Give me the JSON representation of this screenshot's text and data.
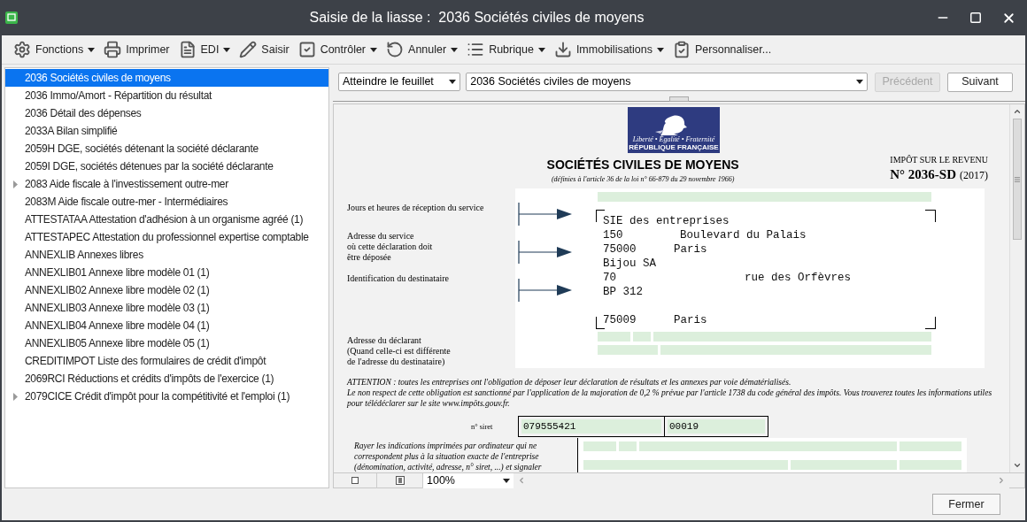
{
  "window": {
    "title": "Saisie de la liasse :  2036 Sociétés civiles de moyens"
  },
  "toolbar": [
    {
      "label": "Fonctions",
      "has_menu": true
    },
    {
      "label": "Imprimer",
      "has_menu": false
    },
    {
      "label": "EDI",
      "has_menu": true
    },
    {
      "label": "Saisir",
      "has_menu": false
    },
    {
      "label": "Contrôler",
      "has_menu": true
    },
    {
      "label": "Annuler",
      "has_menu": true
    },
    {
      "label": "Rubrique",
      "has_menu": true
    },
    {
      "label": "Immobilisations",
      "has_menu": true
    },
    {
      "label": "Personnaliser...",
      "has_menu": false
    }
  ],
  "sidebar": {
    "items": [
      {
        "label": "2036 Sociétés civiles de moyens",
        "kind": "leaf",
        "selected": true
      },
      {
        "label": "2036 Immo/Amort - Répartition du résultat",
        "kind": "leaf",
        "selected": false
      },
      {
        "label": "2036 Détail des dépenses",
        "kind": "leaf",
        "selected": false
      },
      {
        "label": "2033A Bilan simplifié",
        "kind": "leaf",
        "selected": false
      },
      {
        "label": "2059H DGE, sociétés détenant la société déclarante",
        "kind": "leaf",
        "selected": false
      },
      {
        "label": "2059I DGE, sociétés détenues par la société déclarante",
        "kind": "leaf",
        "selected": false
      },
      {
        "label": "2083 Aide fiscale à l'investissement outre-mer",
        "kind": "group",
        "selected": false
      },
      {
        "label": "2083M Aide fiscale outre-mer - Intermédiaires",
        "kind": "leaf",
        "selected": false
      },
      {
        "label": "ATTESTATAA Attestation d'adhésion à un organisme agréé (1)",
        "kind": "leaf",
        "selected": false
      },
      {
        "label": "ATTESTAPEC Attestation du professionnel expertise comptable",
        "kind": "leaf",
        "selected": false
      },
      {
        "label": "ANNEXLIB Annexes libres",
        "kind": "leaf",
        "selected": false
      },
      {
        "label": "ANNEXLIB01 Annexe libre modèle 01 (1)",
        "kind": "leaf",
        "selected": false
      },
      {
        "label": "ANNEXLIB02 Annexe libre modèle 02 (1)",
        "kind": "leaf",
        "selected": false
      },
      {
        "label": "ANNEXLIB03 Annexe libre modèle 03 (1)",
        "kind": "leaf",
        "selected": false
      },
      {
        "label": "ANNEXLIB04 Annexe libre modèle 04 (1)",
        "kind": "leaf",
        "selected": false
      },
      {
        "label": "ANNEXLIB05 Annexe libre modèle 05 (1)",
        "kind": "leaf",
        "selected": false
      },
      {
        "label": "CREDITIMPOT Liste des formulaires de crédit d'impôt",
        "kind": "leaf",
        "selected": false
      },
      {
        "label": "2069RCI Réductions et crédits d'impôts de l'exercice (1)",
        "kind": "leaf",
        "selected": false
      },
      {
        "label": "2079CICE Crédit d'impôt pour la compétitivité et l'emploi (1)",
        "kind": "group",
        "selected": false
      }
    ]
  },
  "navigation": {
    "goto_select": "Atteindre le feuillet",
    "sheet_select": "2036 Sociétés civiles de moyens",
    "previous": {
      "label": "Précédent",
      "disabled": true
    },
    "next": {
      "label": "Suivant",
      "disabled": false
    }
  },
  "form": {
    "logo": {
      "motto": "Liberté • Égalité • Fraternité",
      "name": "RÉPUBLIQUE FRANÇAISE"
    },
    "title": "SOCIÉTÉS CIVILES DE MOYENS",
    "subtitle": "(définies à l'article 36 de la loi n° 66-879 du 29 novembre 1966)",
    "tax_label": "IMPÔT SUR LE REVENU",
    "form_number": "N° 2036-SD",
    "year": "(2017)",
    "labels": {
      "reception": "Jours et heures de réception du service",
      "service": "Adresse du service\noù cette déclaration doit\nêtre déposée",
      "recipient": "Identification du destinataire",
      "declarant": "Adresse du déclarant\n(Quand celle-ci est différente\nde l'adresse du destinataire)"
    },
    "address_lines": [
      {
        "kind": "text",
        "parts": [
          "SIE des entreprises"
        ]
      },
      {
        "kind": "service_street",
        "parts": [
          "150",
          "Boulevard du Palais"
        ]
      },
      {
        "kind": "city",
        "parts": [
          "75000",
          "Paris"
        ]
      },
      {
        "kind": "text",
        "parts": [
          "Bijou SA"
        ]
      },
      {
        "kind": "recipient_street",
        "parts": [
          "70",
          "rue des Orfèvres"
        ]
      },
      {
        "kind": "text",
        "parts": [
          "BP 312"
        ]
      },
      {
        "kind": "gap"
      },
      {
        "kind": "city",
        "parts": [
          "75009",
          "Paris"
        ]
      }
    ],
    "attention": "ATTENTION : toutes les entreprises ont l'obligation de déposer leur déclaration de résultats et les annexes par voie dématérialisés.\nLe non respect de cette obligation est sanctionné par l'application de la majoration de 0,2 % prévue par l'article 1738 du code général des impôts. Vous trouverez toutes les informations utiles pour télédéclarer sur le site www.impôts.gouv.fr.",
    "siret_label": "n° siret",
    "siren": "079555421",
    "nic": "00019",
    "strike_note": "Rayer les indications imprimées par ordinateur qui ne correspondent plus à la situation exacte de l'entreprise (dénomination, activité, adresse, n° siret, ...) et signaler"
  },
  "zoom": "100%",
  "footer": {
    "close": "Fermer"
  }
}
